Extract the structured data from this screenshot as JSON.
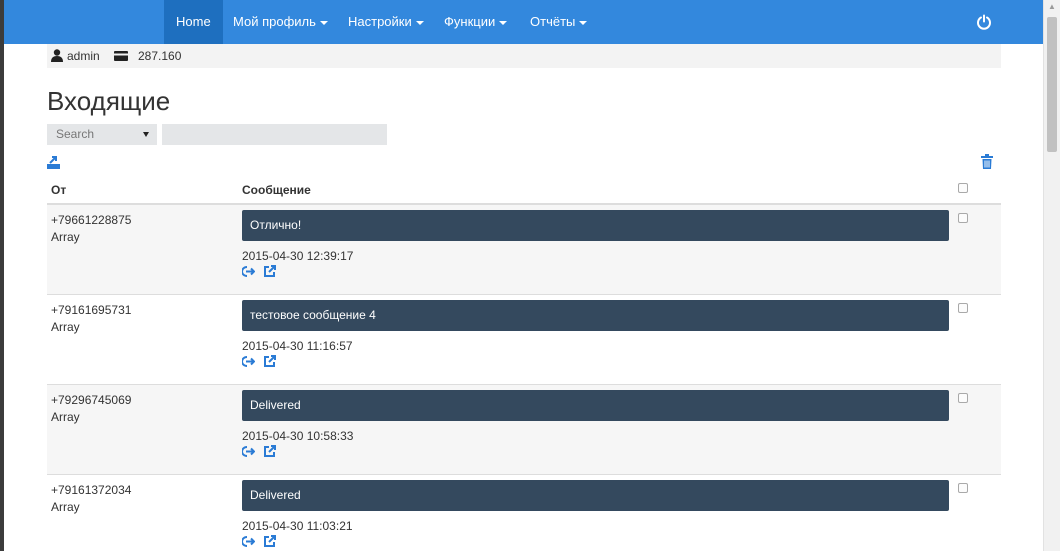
{
  "nav": {
    "items": [
      {
        "label": "Home",
        "has_caret": false,
        "active": true
      },
      {
        "label": "Мой профиль",
        "has_caret": true
      },
      {
        "label": "Настройки",
        "has_caret": true
      },
      {
        "label": "Функции",
        "has_caret": true
      },
      {
        "label": "Отчёты",
        "has_caret": true
      }
    ],
    "right_icon": "power-icon",
    "bg_color": "#3388dd"
  },
  "userbar": {
    "user_icon": "user-icon",
    "username": "admin",
    "balance_icon": "credit-card-icon",
    "balance": "287.160"
  },
  "page": {
    "title": "Входящие"
  },
  "filter": {
    "select_value": "Search",
    "input_value": ""
  },
  "toolbar": {
    "export_icon": "export-icon",
    "delete_icon": "trash-icon"
  },
  "table": {
    "headers": {
      "from": "От",
      "message": "Сообщение"
    },
    "rows": [
      {
        "phone": "+79661228875",
        "sub": "Array",
        "message": "Отлично!",
        "time": "2015-04-30 12:39:17"
      },
      {
        "phone": "+79161695731",
        "sub": "Array",
        "message": "тестовое сообщение 4",
        "time": "2015-04-30 11:16:57"
      },
      {
        "phone": "+79296745069",
        "sub": "Array",
        "message": "Delivered",
        "time": "2015-04-30 10:58:33"
      },
      {
        "phone": "+79161372034",
        "sub": "Array",
        "message": "Delivered",
        "time": "2015-04-30 11:03:21"
      }
    ],
    "row_actions": [
      "reply-icon",
      "open-external-icon"
    ],
    "bubble_color": "#34495e"
  }
}
